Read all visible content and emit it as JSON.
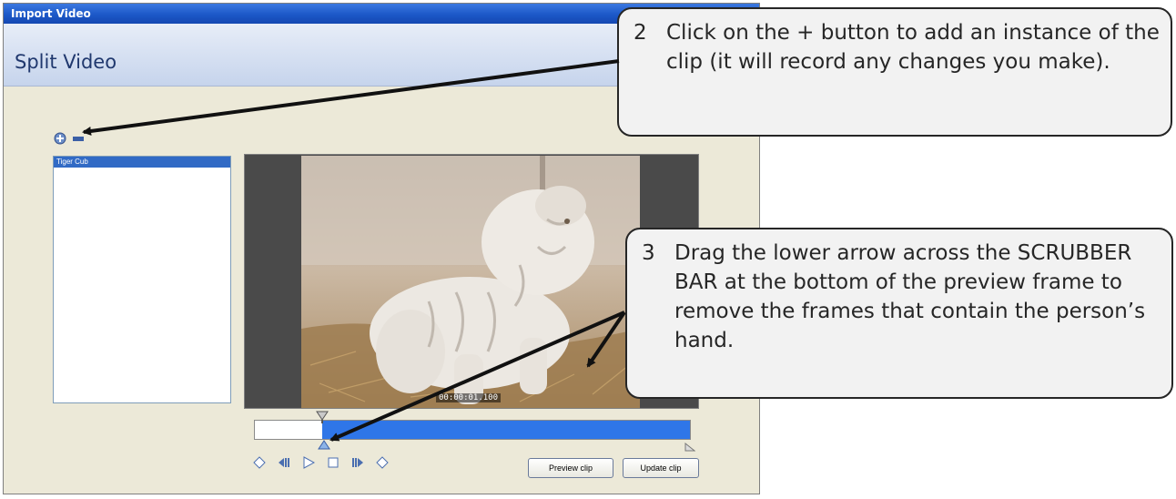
{
  "window": {
    "title": "Import Video",
    "header_title": "Split Video"
  },
  "clip_list": {
    "items": [
      "Tiger Cub"
    ]
  },
  "preview": {
    "timecode": "00:00:01.100"
  },
  "scrubber": {
    "selected_start_fraction": 0.16,
    "selected_end_fraction": 1.0
  },
  "buttons": {
    "preview_clip": "Preview clip",
    "update_clip": "Update clip"
  },
  "callouts": [
    {
      "number": "2",
      "text": "Click on the + button to add an instance of the clip (it will record any changes you make)."
    },
    {
      "number": "3",
      "text": "Drag the lower arrow across the SCRUBBER BAR at the bottom of the preview frame to remove the frames that contain the person’s hand."
    }
  ],
  "colors": {
    "titlebar": "#1c58c8",
    "scrubber_fill": "#2f76e8",
    "selection": "#316ac5",
    "callout_border": "#262626",
    "callout_fill": "#f2f2f2"
  },
  "icons": [
    "add-clip-icon",
    "remove-clip-icon",
    "go-to-start-icon",
    "previous-frame-icon",
    "play-icon",
    "stop-icon",
    "next-frame-icon",
    "go-to-end-icon",
    "scrubber-top-marker-icon",
    "scrubber-bottom-marker-icon"
  ]
}
